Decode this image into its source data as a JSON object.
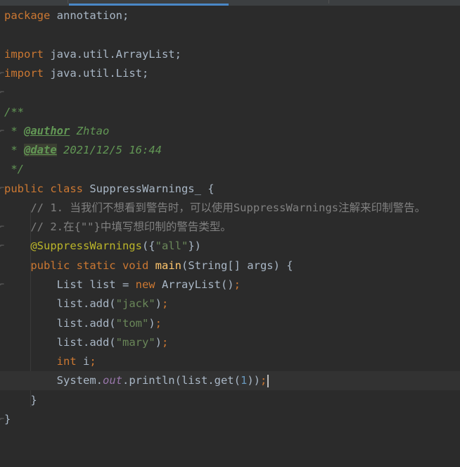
{
  "editor": {
    "line1": {
      "kw": "package",
      "rest": " annotation;"
    },
    "line3": {
      "kw": "import",
      "rest": " java.util.ArrayList;"
    },
    "line4": {
      "kw": "import",
      "rest": " java.util.List;"
    },
    "line6": {
      "text": "/**"
    },
    "line7": {
      "prefix": " * ",
      "tag": "@author",
      "value": " Zhtao"
    },
    "line8": {
      "prefix": " * ",
      "tag": "@date",
      "value": " 2021/12/5 16:44"
    },
    "line9": {
      "text": " */"
    },
    "line10": {
      "kw1": "public",
      "kw2": " class",
      "rest": " SuppressWarnings_ {"
    },
    "line11": {
      "text": "    // 1. 当我们不想看到警告时，可以使用SuppressWarnings注解来印制警告。"
    },
    "line12": {
      "text": "    // 2.在{\"\"}中填写想印制的警告类型。"
    },
    "line13": {
      "indent": "    ",
      "ann": "@SuppressWarnings",
      "open": "({",
      "str": "\"all\"",
      "close": "})"
    },
    "line14": {
      "indent": "    ",
      "kw": "public static void",
      "sp": " ",
      "fn": "main",
      "rest": "(String[] args) {"
    },
    "line15": {
      "indent": "        ",
      "a": "List list = ",
      "kw": "new",
      "b": " ArrayList()",
      "semi": ";"
    },
    "line16": {
      "indent": "        ",
      "a": "list.add(",
      "str": "\"jack\"",
      "b": ")",
      "semi": ";"
    },
    "line17": {
      "indent": "        ",
      "a": "list.add(",
      "str": "\"tom\"",
      "b": ")",
      "semi": ";"
    },
    "line18": {
      "indent": "        ",
      "a": "list.add(",
      "str": "\"mary\"",
      "b": ")",
      "semi": ";"
    },
    "line19": {
      "indent": "        ",
      "kw": "int",
      "a": " i",
      "semi": ";"
    },
    "line20": {
      "indent": "        ",
      "a": "System.",
      "stat": "out",
      "b": ".println(list.get(",
      "num": "1",
      "c": "))",
      "semi": ";"
    },
    "line21": {
      "text": "    }"
    },
    "line22": {
      "text": "}"
    }
  },
  "colors": {
    "background": "#2b2b2b",
    "keyword": "#cc7832",
    "string": "#6a8759",
    "comment": "#808080",
    "doc_comment": "#629755",
    "annotation": "#bbb529",
    "method": "#ffc66d",
    "number": "#6897bb",
    "static_field": "#9876aa",
    "tab_indicator": "#4a88c7"
  }
}
